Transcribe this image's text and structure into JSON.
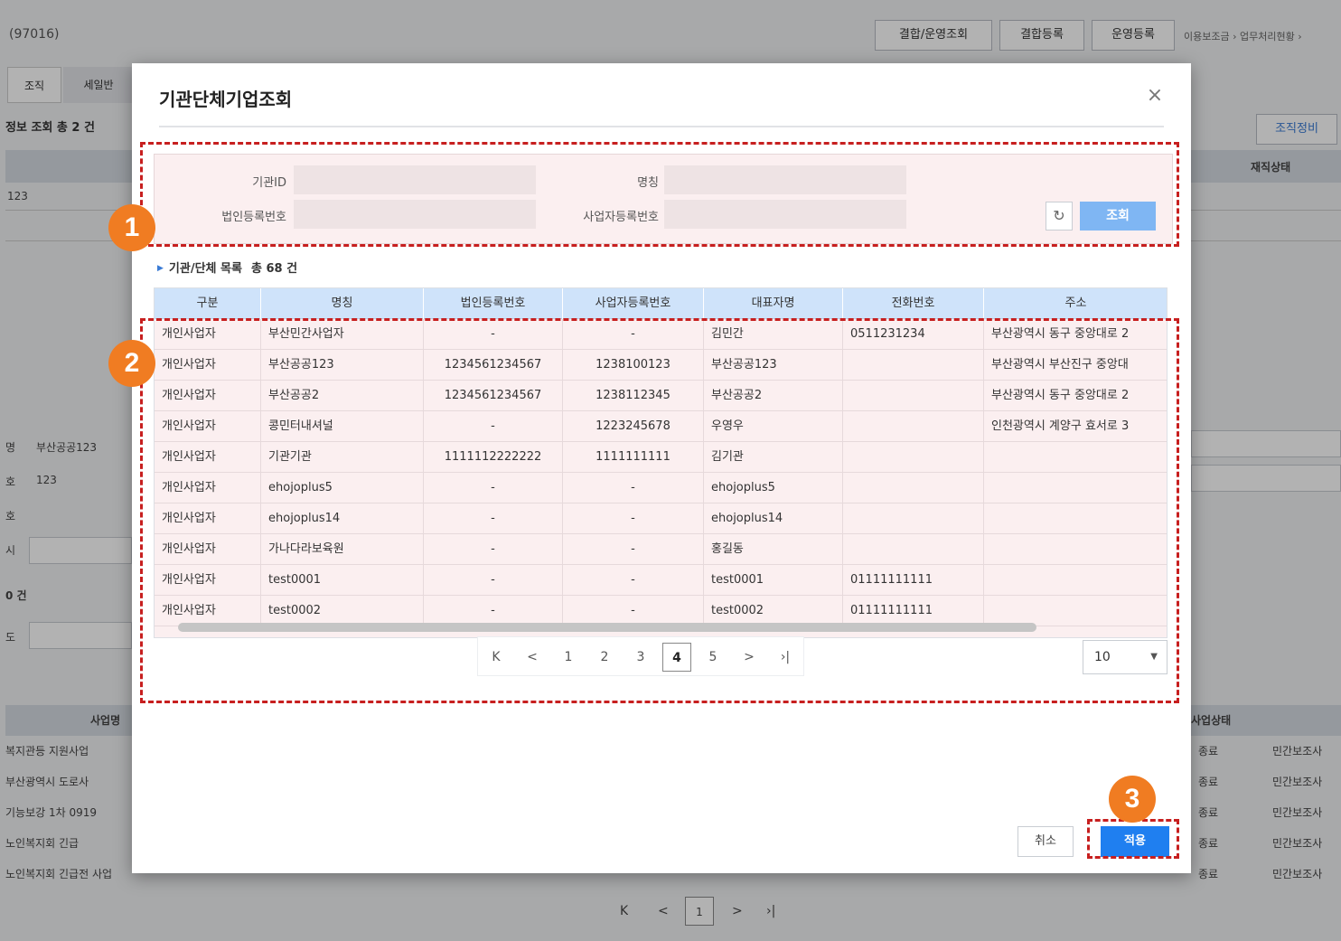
{
  "background": {
    "screen_code": "(97016)",
    "buttons": [
      "결합/운영조회",
      "결합등록",
      "운영등록"
    ],
    "breadcrumb": "이용보조금 › 업무처리현황 ›",
    "tabs": [
      "조직",
      "세일반"
    ],
    "summary": "정보 조회 총 2 건",
    "right_button": "조직정비",
    "col_status": "재직상태",
    "row_value": "123",
    "field1_label": "명",
    "field1_value": "부산공공123",
    "field2_label": "호",
    "field2_value": "123",
    "field3_label": "호",
    "field4_label": "시",
    "count2": "0 건",
    "field5_label": "도",
    "lower_head_left": "사업명",
    "lower_head_right": "사업상태",
    "lower_rows": [
      {
        "left": "복지관등 지원사업",
        "mid": "종료",
        "right": "민간보조사"
      },
      {
        "left": "부산광역시 도로사",
        "mid": "종료",
        "right": "민간보조사"
      },
      {
        "left": "기능보강 1차 0919",
        "mid": "종료",
        "right": "민간보조사"
      },
      {
        "left": "노인복지회 긴급",
        "mid": "종료",
        "right": "민간보조사"
      },
      {
        "left": "노인복지회 긴급전 사업",
        "mid": "종료",
        "right": "민간보조사"
      }
    ],
    "pager_page": "1"
  },
  "modal": {
    "title": "기관단체기업조회",
    "close_glyph": "×",
    "search": {
      "org_id_label": "기관ID",
      "name_label": "명칭",
      "corp_no_label": "법인등록번호",
      "biz_no_label": "사업자등록번호",
      "org_id_value": "",
      "name_value": "",
      "corp_no_value": "",
      "biz_no_value": "",
      "reset_glyph": "↻",
      "search_label": "조회"
    },
    "list": {
      "title": "기관/단체 목록",
      "count": "총 68 건",
      "columns": [
        "구분",
        "명칭",
        "법인등록번호",
        "사업자등록번호",
        "대표자명",
        "전화번호",
        "주소"
      ],
      "rows": [
        [
          "개인사업자",
          "부산민간사업자",
          "-",
          "-",
          "김민간",
          "0511231234",
          "부산광역시 동구 중앙대로 2"
        ],
        [
          "개인사업자",
          "부산공공123",
          "1234561234567",
          "1238100123",
          "부산공공123",
          "",
          "부산광역시 부산진구 중앙대"
        ],
        [
          "개인사업자",
          "부산공공2",
          "1234561234567",
          "1238112345",
          "부산공공2",
          "",
          "부산광역시 동구 중앙대로 2"
        ],
        [
          "개인사업자",
          "콩민터내셔널",
          "-",
          "1223245678",
          "우영우",
          "",
          "인천광역시 계양구 효서로 3"
        ],
        [
          "개인사업자",
          "기관기관",
          "1111112222222",
          "1111111111",
          "김기관",
          "",
          ""
        ],
        [
          "개인사업자",
          "ehojoplus5",
          "-",
          "-",
          "ehojoplus5",
          "",
          ""
        ],
        [
          "개인사업자",
          "ehojoplus14",
          "-",
          "-",
          "ehojoplus14",
          "",
          ""
        ],
        [
          "개인사업자",
          "가나다라보육원",
          "-",
          "-",
          "홍길동",
          "",
          ""
        ],
        [
          "개인사업자",
          "test0001",
          "-",
          "-",
          "test0001",
          "01111111111",
          ""
        ],
        [
          "개인사업자",
          "test0002",
          "-",
          "-",
          "test0002",
          "01111111111",
          ""
        ]
      ]
    },
    "pagination": {
      "first": "K",
      "prev": "<",
      "pages": [
        "1",
        "2",
        "3",
        "4",
        "5"
      ],
      "current": "4",
      "next": ">",
      "last": "›|",
      "page_size": "10"
    },
    "cancel_label": "취소",
    "apply_label": "적용"
  },
  "annotations": [
    "1",
    "2",
    "3"
  ],
  "colors": {
    "accent": "#1f7ff0",
    "annotation_border": "#c71f1f",
    "annotation_badge": "#f07c22"
  }
}
